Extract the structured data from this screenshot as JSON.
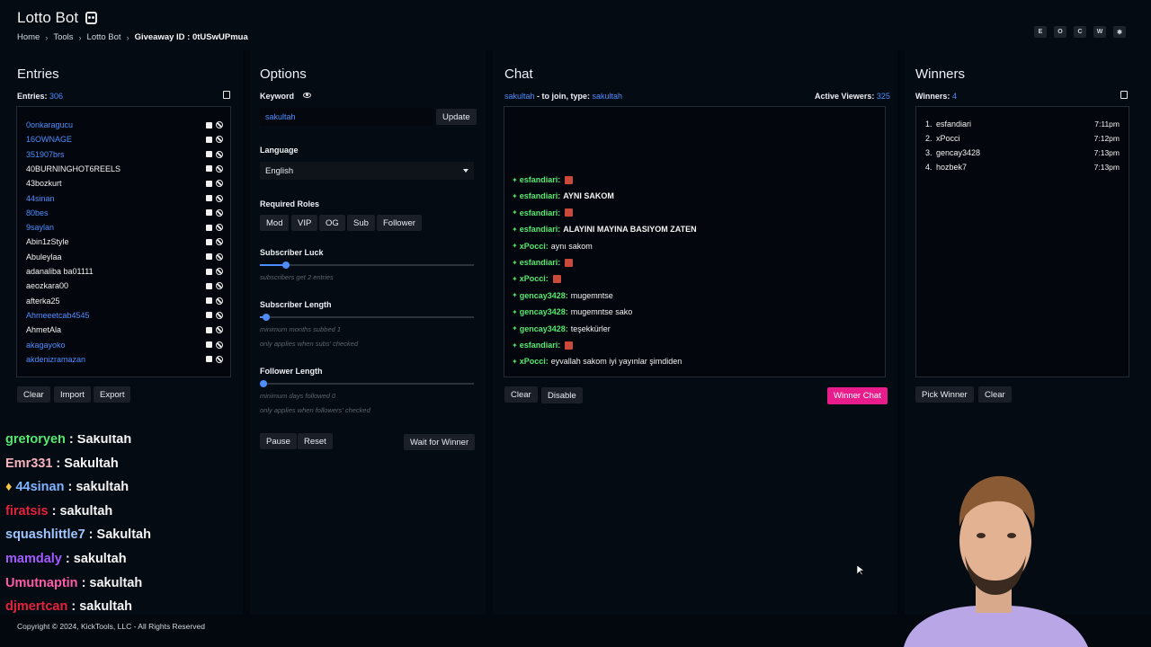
{
  "app": {
    "title": "Lotto Bot"
  },
  "breadcrumb": [
    "Home",
    "Tools",
    "Lotto Bot",
    "Giveaway ID : 0tUSwUPmua"
  ],
  "top_buttons": [
    "E",
    "O",
    "C",
    "W",
    "✱"
  ],
  "entries": {
    "title": "Entries",
    "count_label": "Entries:",
    "count": "306",
    "list": [
      {
        "name": "0onkaragucu",
        "color": "blue"
      },
      {
        "name": "16OWNAGE",
        "color": "blue"
      },
      {
        "name": "351907brs",
        "color": "blue"
      },
      {
        "name": "40BURNINGHOT6REELS",
        "color": "white"
      },
      {
        "name": "43bozkurt",
        "color": "white"
      },
      {
        "name": "44sinan",
        "color": "blue"
      },
      {
        "name": "80bes",
        "color": "blue"
      },
      {
        "name": "9saylan",
        "color": "blue"
      },
      {
        "name": "Abin1zStyle",
        "color": "white"
      },
      {
        "name": "Abuleylaa",
        "color": "white"
      },
      {
        "name": "adanaliba ba01111",
        "color": "white"
      },
      {
        "name": "aeozkara00",
        "color": "white"
      },
      {
        "name": "afterka25",
        "color": "white"
      },
      {
        "name": "Ahmeeetcab4545",
        "color": "blue"
      },
      {
        "name": "AhmetAla",
        "color": "white"
      },
      {
        "name": "akagayoko",
        "color": "blue"
      },
      {
        "name": "akdenizramazan",
        "color": "blue"
      }
    ],
    "buttons": [
      "Clear",
      "Import",
      "Export"
    ]
  },
  "options": {
    "title": "Options",
    "keyword_label": "Keyword",
    "keyword_value": "sakultah",
    "update_button": "Update",
    "language_label": "Language",
    "language_value": "English",
    "roles_label": "Required Roles",
    "roles": [
      "Mod",
      "VIP",
      "OG",
      "Sub",
      "Follower"
    ],
    "sub_luck_label": "Subscriber Luck",
    "sub_luck_hint": "subscribers get 2 entries",
    "sub_luck_level": 0.12,
    "sub_length_label": "Subscriber Length",
    "sub_length_hint1": "minimum months subbed 1",
    "sub_length_hint2": "only applies when subs' checked",
    "sub_length_level": 0.03,
    "follower_length_label": "Follower Length",
    "follower_length_hint1": "minimum days followed 0",
    "follower_length_hint2": "only applies when followers' checked",
    "follower_length_level": 0.0,
    "pause_button": "Pause",
    "reset_button": "Reset",
    "wait_button": "Wait for Winner"
  },
  "chat": {
    "title": "Chat",
    "join_user": "sakultah",
    "join_text": " - to join, type: ",
    "join_keyword": "sakultah",
    "viewers_label": "Active Viewers:",
    "viewers_count": "325",
    "messages": [
      {
        "user": "esfandiari:",
        "text": "",
        "emote": true
      },
      {
        "user": "esfandiari:",
        "text": "AYNI SAKOM",
        "emote": false
      },
      {
        "user": "esfandiari:",
        "text": "",
        "emote": true
      },
      {
        "user": "esfandiari:",
        "text": "ALAYINI MAYINA BASIYOM ZATEN",
        "emote": false
      },
      {
        "user": "xPocci:",
        "text": "aynı sakom",
        "emote": false
      },
      {
        "user": "esfandiari:",
        "text": "",
        "emote": true
      },
      {
        "user": "xPocci:",
        "text": "",
        "emote": true
      },
      {
        "user": "gencay3428:",
        "text": "mugemntse",
        "emote": false
      },
      {
        "user": "gencay3428:",
        "text": "mugemntse sako",
        "emote": false
      },
      {
        "user": "gencay3428:",
        "text": "teşekkürler",
        "emote": false
      },
      {
        "user": "esfandiari:",
        "text": "",
        "emote": true
      },
      {
        "user": "xPocci:",
        "text": "eyvallah sakom iyi yayınlar şimdiden",
        "emote": false
      }
    ],
    "clear_button": "Clear",
    "disable_button": "Disable",
    "winner_chat_button": "Winner Chat"
  },
  "winners": {
    "title": "Winners",
    "count_label": "Winners:",
    "count": "4",
    "list": [
      {
        "num": "1.",
        "name": "esfandiari",
        "time": "7:11pm"
      },
      {
        "num": "2.",
        "name": "xPocci",
        "time": "7:12pm"
      },
      {
        "num": "3.",
        "name": "gencay3428",
        "time": "7:13pm"
      },
      {
        "num": "4.",
        "name": "hozbek7",
        "time": "7:13pm"
      }
    ],
    "pick_button": "Pick Winner",
    "clear_button": "Clear"
  },
  "stream_chat": [
    {
      "user": "greforyeh",
      "text": " : Sakultah",
      "color": "#56e86f"
    },
    {
      "user": "Emr331",
      "text": " : Sakultah",
      "color": "#f8b3c0"
    },
    {
      "user": "44sinan",
      "text": " : sakultah",
      "color": "#7fb4ff"
    },
    {
      "user": "firatsis",
      "text": " : sakultah",
      "color": "#e6213c"
    },
    {
      "user": "squashlittle7",
      "text": " : Sakultah",
      "color": "#9ec6ff"
    },
    {
      "user": "mamdaly",
      "text": " : sakultah",
      "color": "#a35bff"
    },
    {
      "user": "Umutnaptin",
      "text": " : sakultah",
      "color": "#ff5aa8"
    },
    {
      "user": "djmertcan",
      "text": " : sakultah",
      "color": "#e6213c"
    }
  ],
  "footer": "Copyright © 2024, KickTools, LLC - All Rights Reserved",
  "colors": {
    "accent": "#4d8dff",
    "pink": "#e81c8a",
    "chat_user": "#56e86f"
  }
}
